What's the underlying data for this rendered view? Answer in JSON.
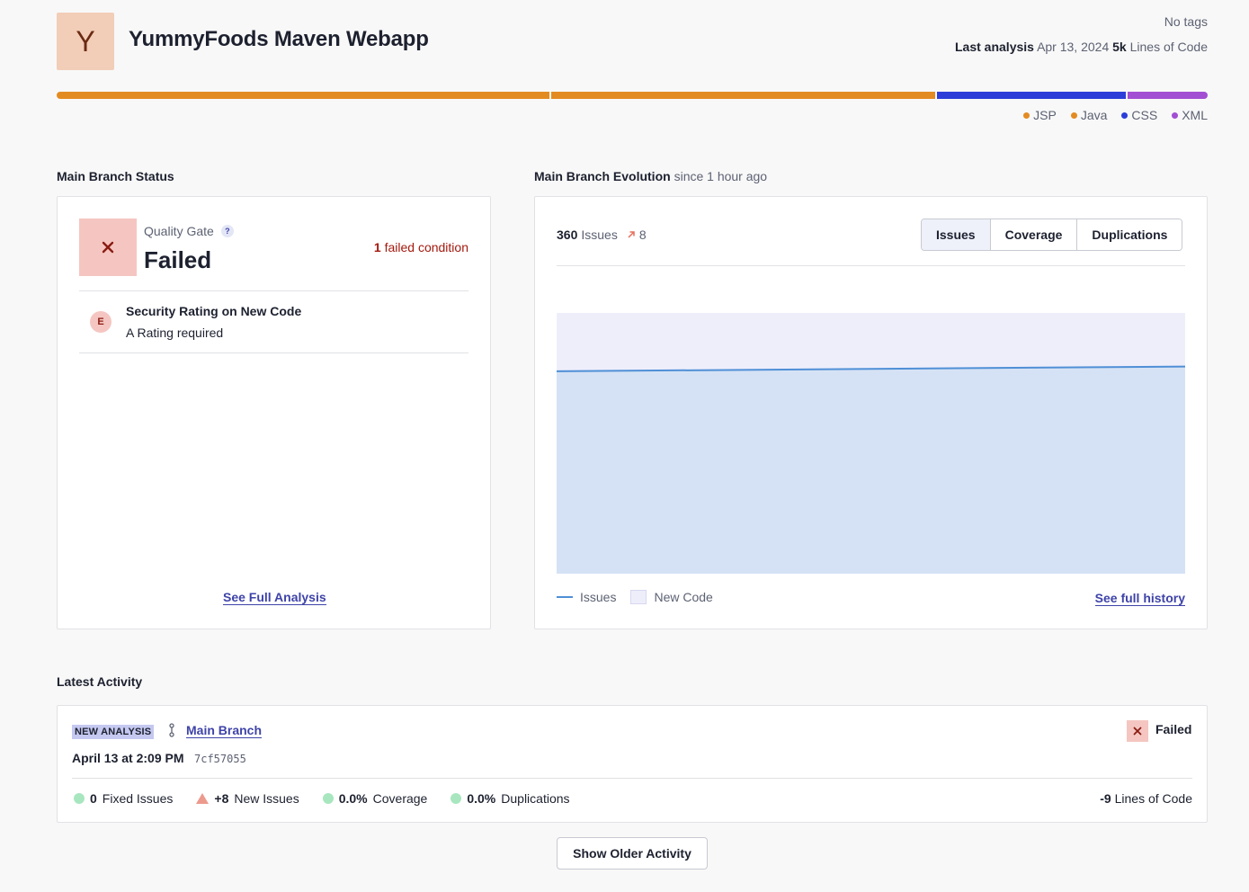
{
  "project": {
    "avatar_letter": "Y",
    "name": "YummyFoods Maven Webapp",
    "tags": "No tags",
    "last_analysis_label": "Last analysis",
    "last_analysis_date": "Apr 13, 2024",
    "loc_value": "5k",
    "loc_label": "Lines of Code"
  },
  "languages": [
    {
      "name": "JSP",
      "share": 0.43,
      "color": "#e38b23"
    },
    {
      "name": "Java",
      "share": 0.335,
      "color": "#e38b23"
    },
    {
      "name": "CSS",
      "share": 0.165,
      "color": "#2d3ed8"
    },
    {
      "name": "XML",
      "share": 0.07,
      "color": "#a24fd3"
    }
  ],
  "status": {
    "section_title": "Main Branch Status",
    "qg_label": "Quality Gate",
    "qg_help": "?",
    "qg_status": "Failed",
    "qg_icon": "x-icon",
    "failed_count": "1",
    "failed_text": "failed condition",
    "condition": {
      "rating": "E",
      "title": "Security Rating on New Code",
      "subtitle": "A Rating required"
    },
    "see_full_analysis": "See Full Analysis"
  },
  "evolution": {
    "section_title": "Main Branch Evolution",
    "since": "since 1 hour ago",
    "issues_value": "360",
    "issues_label": "Issues",
    "trend_icon": "arrow-up-right-icon",
    "trend_value": "8",
    "tabs": [
      "Issues",
      "Coverage",
      "Duplications"
    ],
    "active_tab": "Issues",
    "legend_issues": "Issues",
    "legend_new_code": "New Code",
    "see_full_history": "See full history"
  },
  "chart_data": {
    "type": "area",
    "series": [
      {
        "name": "Issues",
        "values": [
          352,
          360
        ]
      }
    ],
    "new_code_period": true,
    "line_color": "#4f8fd6",
    "fill_color": "#d5e2f5",
    "new_code_color": "#eeeefb"
  },
  "activity": {
    "section_title": "Latest Activity",
    "badge": "NEW ANALYSIS",
    "branch": "Main Branch",
    "date": "April 13 at 2:09 PM",
    "hash": "7cf57055",
    "status": "Failed",
    "stats": {
      "fixed_value": "0",
      "fixed_label": "Fixed Issues",
      "new_value": "+8",
      "new_label": "New Issues",
      "coverage_value": "0.0%",
      "coverage_label": "Coverage",
      "dup_value": "0.0%",
      "dup_label": "Duplications"
    },
    "loc_value": "-9",
    "loc_label": "Lines of Code",
    "older_button": "Show Older Activity"
  }
}
